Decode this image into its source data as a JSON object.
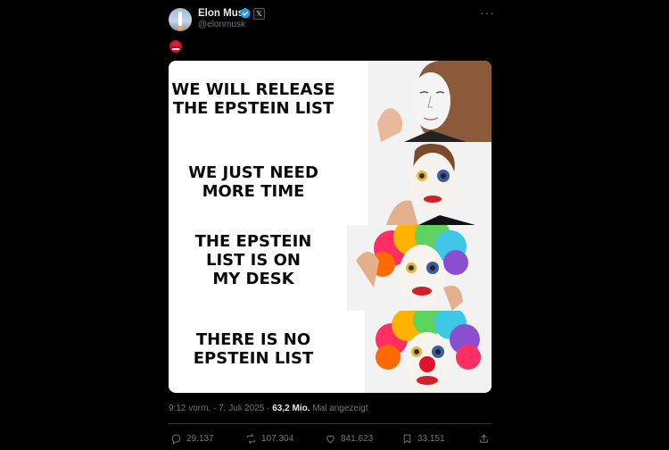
{
  "author": {
    "name": "Elon Musk",
    "handle": "@elonmusk",
    "badge": "𝕏"
  },
  "meme": {
    "captions": [
      "WE WILL RELEASE\nTHE EPSTEIN LIST",
      "WE JUST NEED\nMORE TIME",
      "THE EPSTEIN\nLIST IS ON\nMY DESK",
      "THERE IS NO\nEPSTEIN LIST"
    ]
  },
  "meta": {
    "time": "9:12 vorm.",
    "date": "7. Juli 2025",
    "views_count": "63,2 Mio.",
    "views_label": "Mal angezeigt",
    "sep": "·"
  },
  "actions": {
    "replies": "29.137",
    "reposts": "107.304",
    "likes": "841.623",
    "bookmarks": "33.151"
  },
  "colors": {
    "verified": "#1d9bf0",
    "muted": "#71767b",
    "text": "#e7e9ea"
  }
}
